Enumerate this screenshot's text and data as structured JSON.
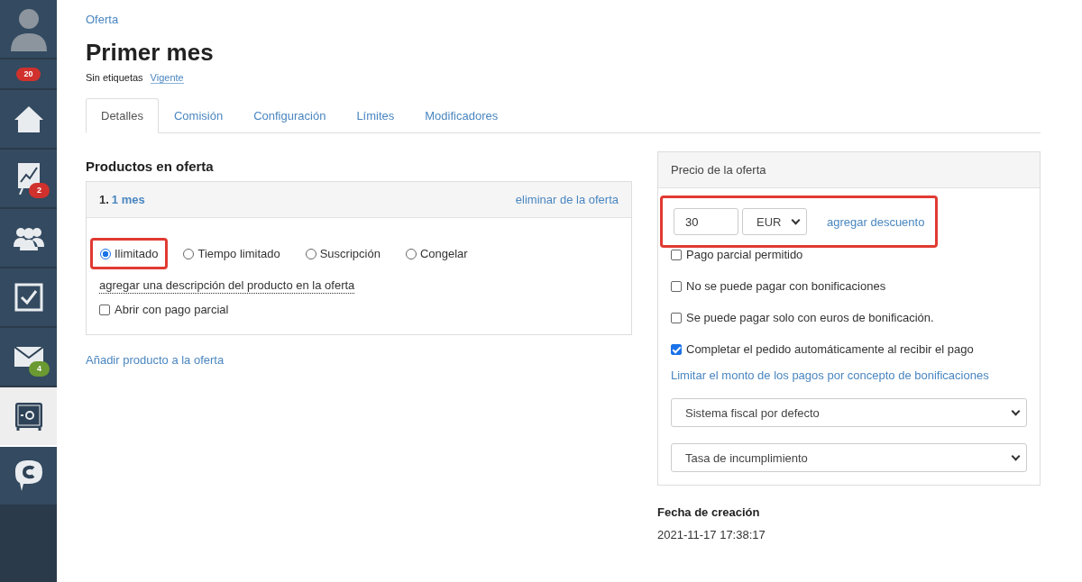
{
  "sidebar": {
    "items": [
      {
        "kind": "avatar",
        "selected": false
      },
      {
        "kind": "badge-only",
        "badge": "20",
        "color": "#d0312d",
        "selected": false
      },
      {
        "kind": "home",
        "selected": false
      },
      {
        "kind": "chart",
        "badge": "2",
        "color": "#d0312d",
        "selected": false
      },
      {
        "kind": "people",
        "selected": false
      },
      {
        "kind": "tasks",
        "selected": false
      },
      {
        "kind": "mail",
        "badge": "4",
        "color": "#6b9a33",
        "selected": false
      },
      {
        "kind": "safe",
        "selected": true
      },
      {
        "kind": "chat",
        "selected": false
      }
    ]
  },
  "breadcrumb": "Oferta",
  "title": "Primer mes",
  "tags_label": "Sin etiquetas",
  "status": "Vigente",
  "tabs": [
    {
      "label": "Detalles",
      "selected": true
    },
    {
      "label": "Comisión",
      "selected": false
    },
    {
      "label": "Configuración",
      "selected": false
    },
    {
      "label": "Límites",
      "selected": false
    },
    {
      "label": "Modificadores",
      "selected": false
    }
  ],
  "products": {
    "heading": "Productos en oferta",
    "items": [
      {
        "number": "1.",
        "name": "1 mes",
        "remove": "eliminar de la oferta",
        "types": [
          {
            "label": "Ilimitado",
            "selected": true,
            "highlighted": true
          },
          {
            "label": "Tiempo limitado",
            "selected": false,
            "highlighted": false
          },
          {
            "label": "Suscripción",
            "selected": false,
            "highlighted": false
          },
          {
            "label": "Congelar",
            "selected": false,
            "highlighted": false
          }
        ],
        "description_link": "agregar una descripción del producto en la oferta",
        "partial": {
          "label": "Abrir con pago parcial",
          "checked": false
        }
      }
    ],
    "add_link": "Añadir producto a la oferta"
  },
  "price": {
    "heading": "Precio de la oferta",
    "amount": "30",
    "currency": "EUR",
    "highlighted": true,
    "discount_link": "agregar descuento",
    "options": [
      {
        "label": "Pago parcial permitido",
        "checked": false
      },
      {
        "label": "No se puede pagar con bonificaciones",
        "checked": false
      },
      {
        "label": "Se puede pagar solo con euros de bonificación.",
        "checked": false
      },
      {
        "label": "Completar el pedido automáticamente al recibir el pago",
        "checked": true
      }
    ],
    "limit_link": "Limitar el monto de los pagos por concepto de bonificaciones",
    "selects": [
      "Sistema fiscal por defecto",
      "Tasa de incumplimiento"
    ]
  },
  "created": {
    "label": "Fecha de creación",
    "value": "2021-11-17 17:38:17"
  }
}
